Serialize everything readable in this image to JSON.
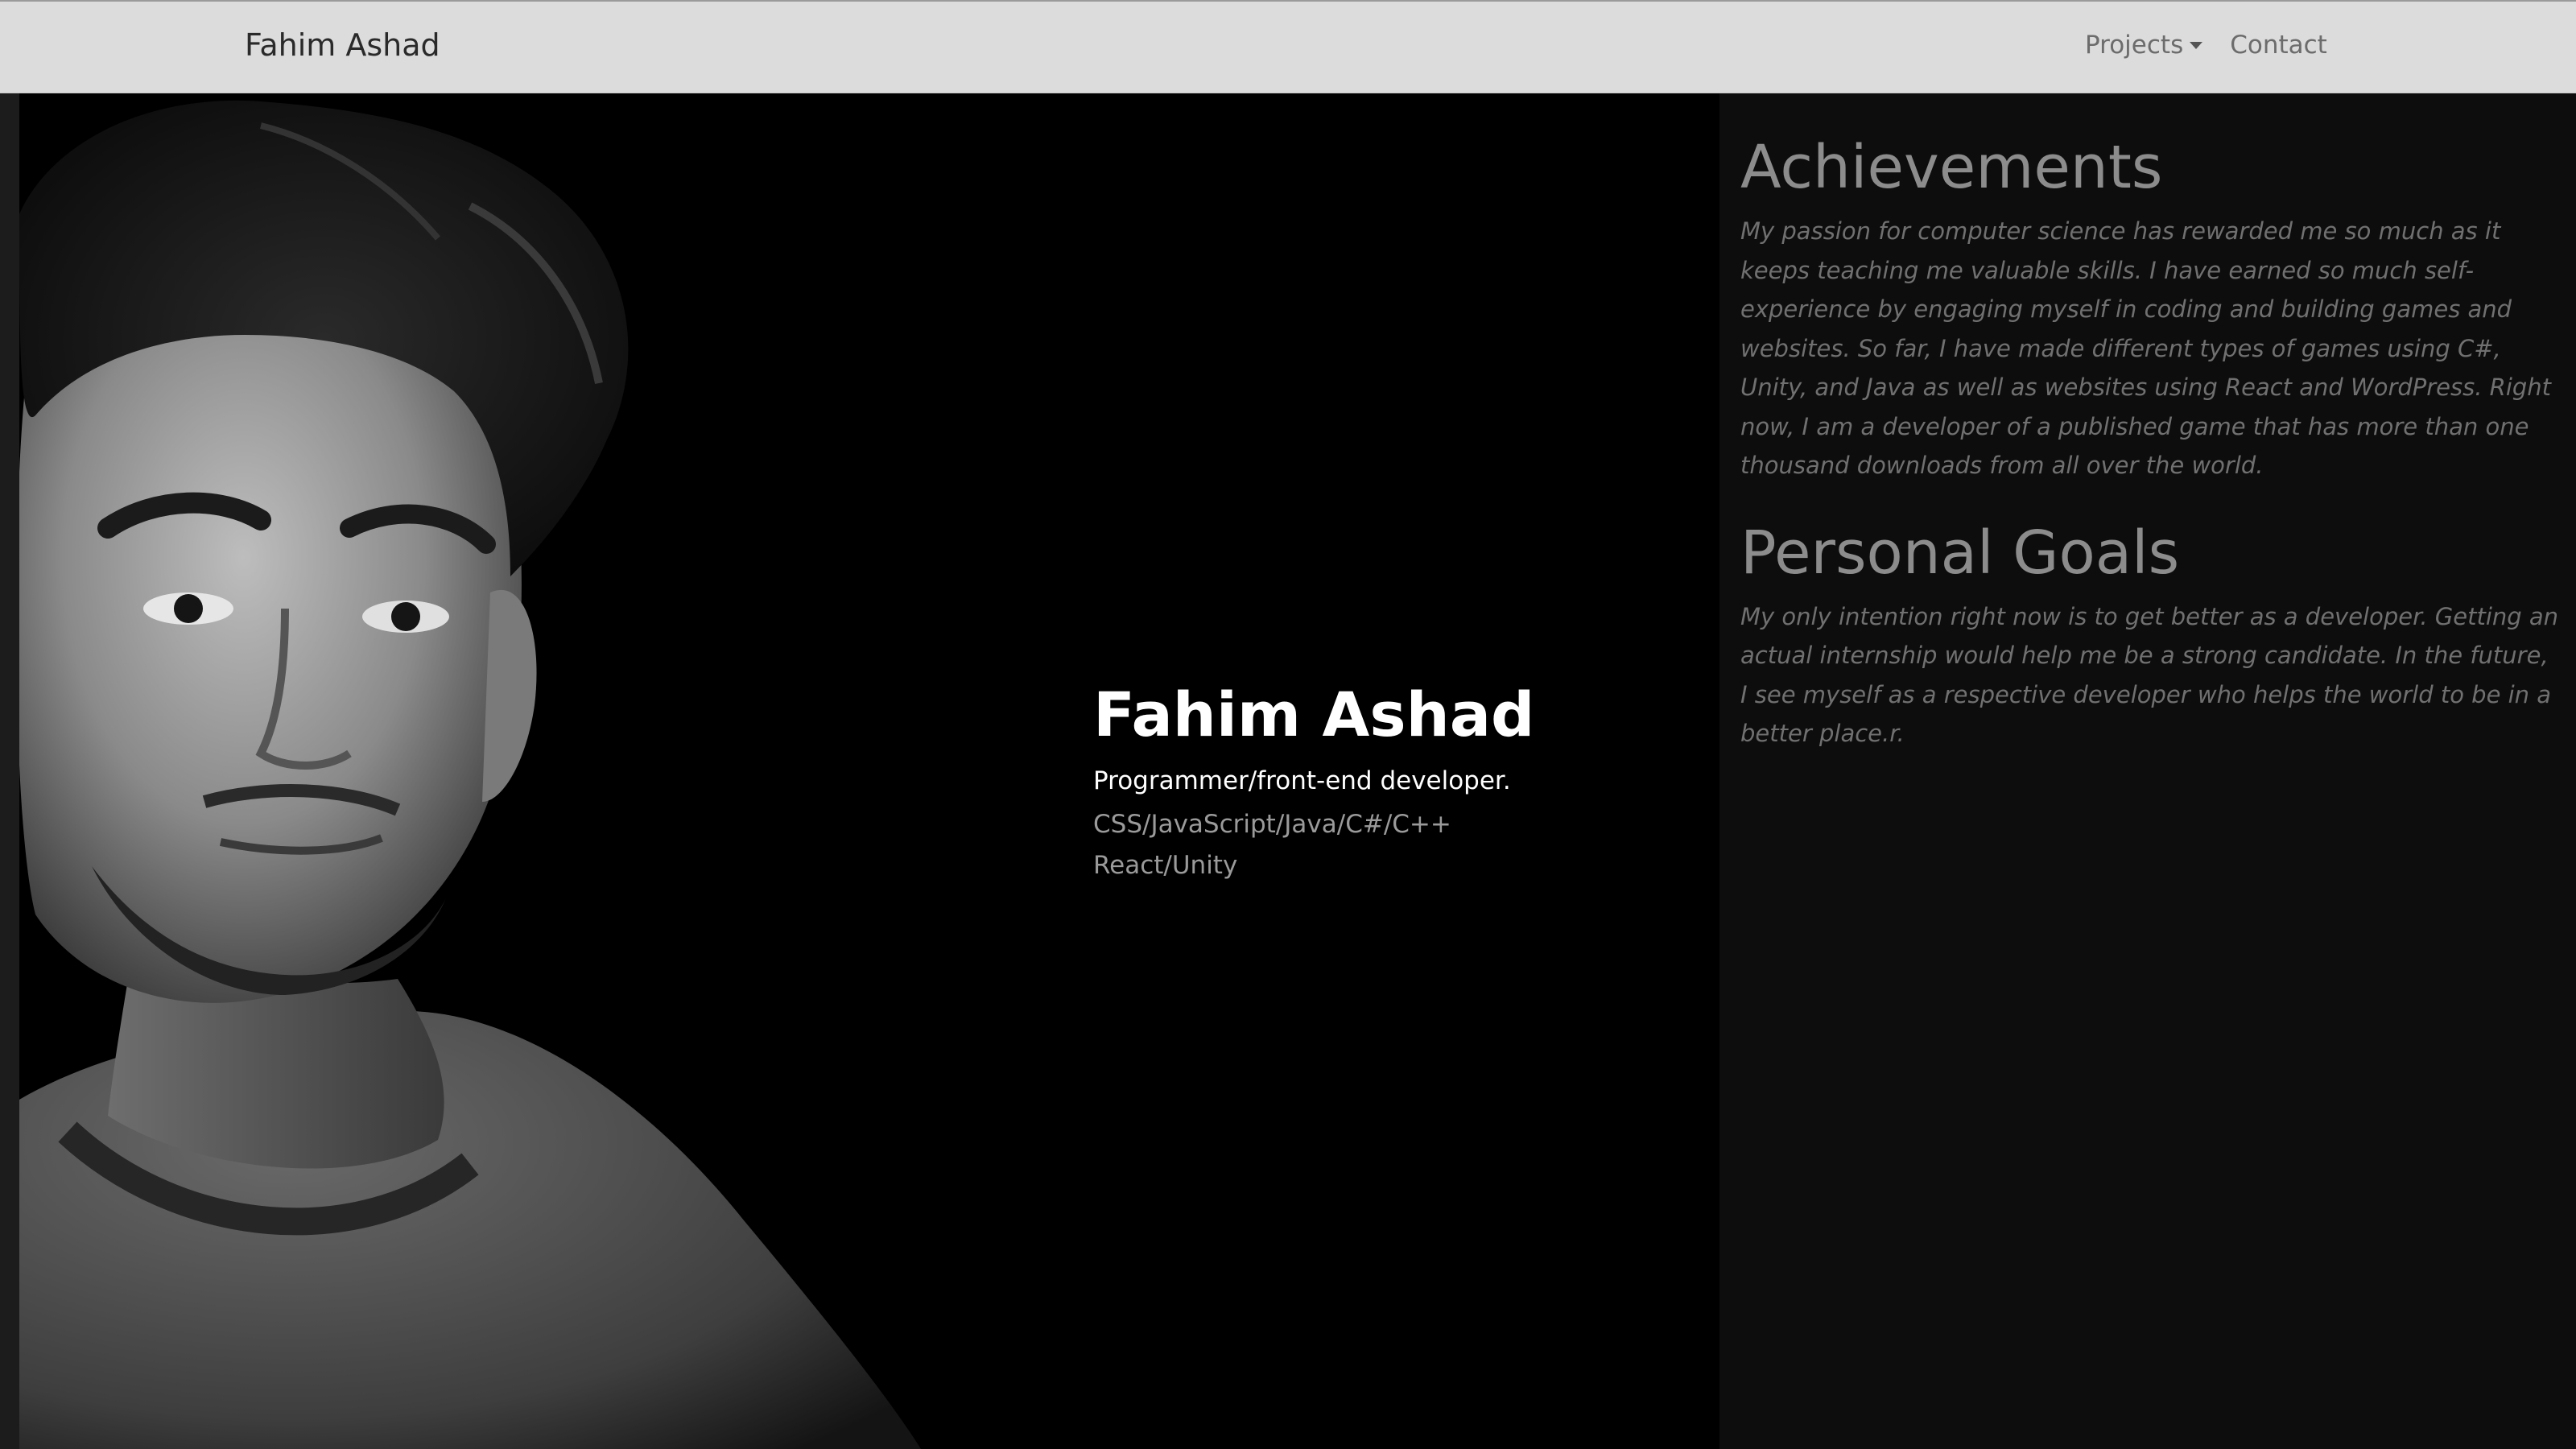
{
  "navbar": {
    "brand": "Fahim Ashad",
    "links": [
      {
        "label": "Projects",
        "has_dropdown": true
      },
      {
        "label": "Contact",
        "has_dropdown": false
      }
    ],
    "background": "#dcdcdc"
  },
  "hero": {
    "name": "Fahim Ashad",
    "role": "Programmer/front-end developer.",
    "skills": [
      "CSS/JavaScript/Java/C#/C++",
      "React/Unity"
    ],
    "background": "#000000"
  },
  "sidebar": {
    "achievements": {
      "title": "Achievements",
      "text": "My passion for computer science has rewarded me so much as it keeps teaching me valuable skills. I have earned so much self-experience by engaging myself in coding and building games and websites. So far, I have made different types of games using C#, Unity, and Java as well as websites using React and WordPress. Right now, I am a developer of a published game that has more than one thousand downloads from all over the world."
    },
    "goals": {
      "title": "Personal Goals",
      "text": "My only intention right now is to get better as a developer. Getting an actual internship would help me be a strong candidate. In the future, I see myself as a respective developer who helps the world to be in a better place.r."
    },
    "background": "#0d0d0d"
  }
}
